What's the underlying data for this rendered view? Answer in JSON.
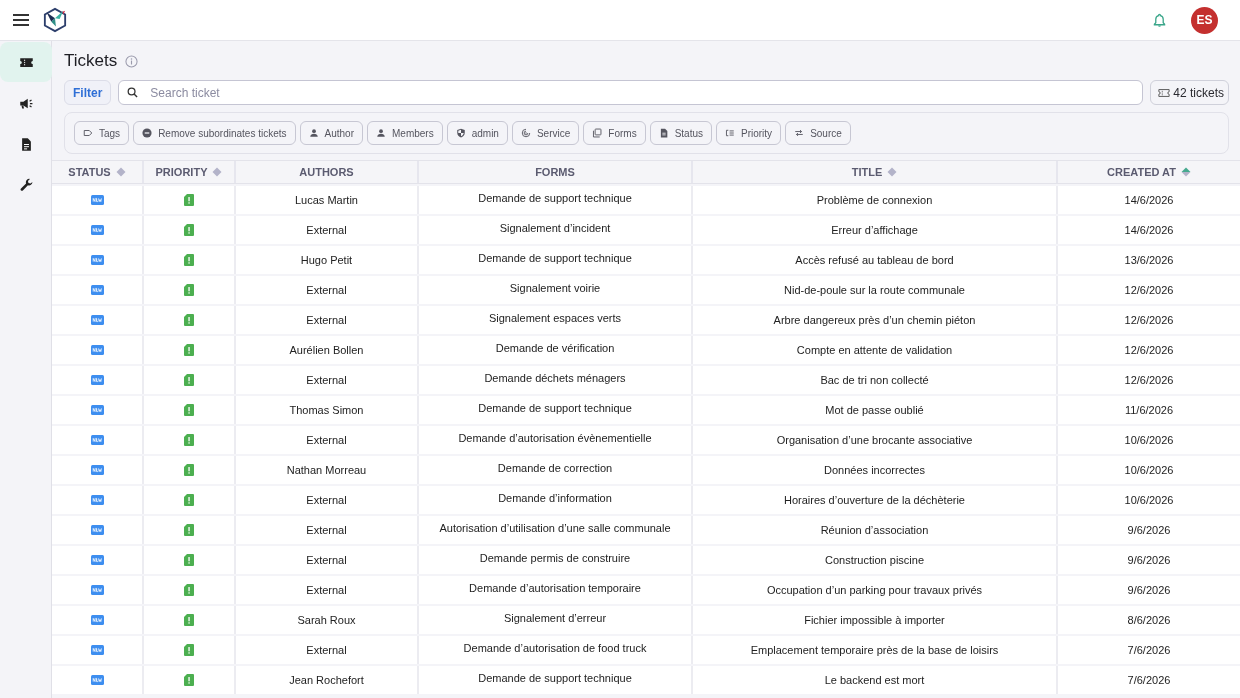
{
  "header": {
    "avatar_initials": "ES"
  },
  "sidebar": {
    "items": [
      {
        "selected": true
      },
      {
        "selected": false
      },
      {
        "selected": false
      },
      {
        "selected": false
      }
    ]
  },
  "page": {
    "title": "Tickets"
  },
  "filter_button": "Filter",
  "search": {
    "placeholder": "Search ticket"
  },
  "ticket_count": "42 tickets",
  "filter_chips": [
    {
      "label": "Tags"
    },
    {
      "label": "Remove subordinates tickets"
    },
    {
      "label": "Author"
    },
    {
      "label": "Members"
    },
    {
      "label": "admin"
    },
    {
      "label": "Service"
    },
    {
      "label": "Forms"
    },
    {
      "label": "Status"
    },
    {
      "label": "Priority"
    },
    {
      "label": "Source"
    }
  ],
  "table": {
    "columns": [
      {
        "label": "STATUS",
        "sortable": true,
        "sorted": false
      },
      {
        "label": "PRIORITY",
        "sortable": true,
        "sorted": false
      },
      {
        "label": "AUTHORS",
        "sortable": false
      },
      {
        "label": "FORMS",
        "sortable": false
      },
      {
        "label": "TITLE",
        "sortable": true,
        "sorted": false
      },
      {
        "label": "CREATED AT",
        "sortable": true,
        "sorted": true
      }
    ],
    "rows": [
      {
        "author": "Lucas Martin",
        "form": "Demande de support technique",
        "title": "Problème de connexion",
        "created_at": "14/6/2026"
      },
      {
        "author": "External",
        "form": "Signalement d’incident",
        "title": "Erreur d’affichage",
        "created_at": "14/6/2026"
      },
      {
        "author": "Hugo Petit",
        "form": "Demande de support technique",
        "title": "Accès refusé au tableau de bord",
        "created_at": "13/6/2026"
      },
      {
        "author": "External",
        "form": "Signalement voirie",
        "title": "Nid-de-poule sur la route communale",
        "created_at": "12/6/2026"
      },
      {
        "author": "External",
        "form": "Signalement espaces verts",
        "title": "Arbre dangereux près d’un chemin piéton",
        "created_at": "12/6/2026"
      },
      {
        "author": "Aurélien Bollen",
        "form": "Demande de vérification",
        "title": "Compte en attente de validation",
        "created_at": "12/6/2026"
      },
      {
        "author": "External",
        "form": "Demande déchets ménagers",
        "title": "Bac de tri non collecté",
        "created_at": "12/6/2026"
      },
      {
        "author": "Thomas Simon",
        "form": "Demande de support technique",
        "title": "Mot de passe oublié",
        "created_at": "11/6/2026"
      },
      {
        "author": "External",
        "form": "Demande d’autorisation évènementielle",
        "title": "Organisation d’une brocante associative",
        "created_at": "10/6/2026"
      },
      {
        "author": "Nathan Morreau",
        "form": "Demande de correction",
        "title": "Données incorrectes",
        "created_at": "10/6/2026"
      },
      {
        "author": "External",
        "form": "Demande d’information",
        "title": "Horaires d’ouverture de la déchèterie",
        "created_at": "10/6/2026"
      },
      {
        "author": "External",
        "form": "Autorisation d’utilisation d’une salle communale",
        "title": "Réunion d’association",
        "created_at": "9/6/2026"
      },
      {
        "author": "External",
        "form": "Demande permis de construire",
        "title": "Construction piscine",
        "created_at": "9/6/2026"
      },
      {
        "author": "External",
        "form": "Demande d’autorisation temporaire",
        "title": "Occupation d’un parking pour travaux privés",
        "created_at": "9/6/2026"
      },
      {
        "author": "Sarah Roux",
        "form": "Signalement d’erreur",
        "title": "Fichier impossible à importer",
        "created_at": "8/6/2026"
      },
      {
        "author": "External",
        "form": "Demande d’autorisation de food truck",
        "title": "Emplacement temporaire près de la base de loisirs",
        "created_at": "7/6/2026"
      },
      {
        "author": "Jean Rochefort",
        "form": "Demande de support technique",
        "title": "Le backend est mort",
        "created_at": "7/6/2026"
      }
    ]
  }
}
